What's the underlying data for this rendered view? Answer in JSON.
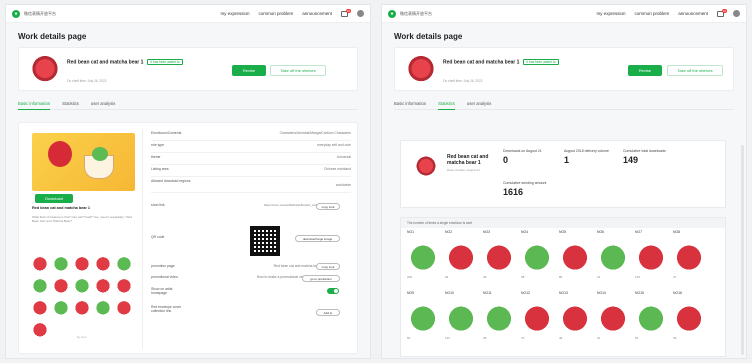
{
  "app": {
    "name": "微信表情开放平台"
  },
  "nav": {
    "my_expression": "my expression",
    "common_problem": "common problem",
    "announcement": "announcement",
    "badge": "10"
  },
  "page_title": "Work details page",
  "work": {
    "name": "Red bean cat and matcha bear 1",
    "tag": "It has been added to",
    "shelf_time": "On shelf time: July 26, 2022",
    "revise_label": "Revise",
    "take_off_label": "Take off the shelves"
  },
  "tabs": [
    "Basic information",
    "Statistics",
    "user analysis"
  ],
  "left": {
    "download_label": "Download",
    "side_name": "Red bean cat and matcha bear 1",
    "description": "What kind of creature is this? Can eat? Fluid? Yes, meet it separately: \"Red Bean Cat\" and \"Matcha Bear\"!",
    "footnote": "by luvc",
    "info": [
      {
        "k": "Emoticons/Contents",
        "v": "Characters/Animals/Manga/Cartoon Characters"
      },
      {
        "k": "role type",
        "v": "everyday self and cute"
      },
      {
        "k": "theme",
        "v": "Universal"
      },
      {
        "k": "Listing area",
        "v": "Chinese mainland"
      },
      {
        "k": "Allowed download regions",
        "v": "worldwide"
      },
      {
        "k": "short link",
        "v": "https://xxxx.xxxx/ezl6eh4/eHhcs/ac_cxdunvs"
      },
      {
        "k": "QR code",
        "v": ""
      },
      {
        "k": "promotion page",
        "v": "Red bean cat and matcha bear 1"
      },
      {
        "k": "promotional video",
        "v": "How to make a promotional video?"
      },
      {
        "k": "Show on artist homepage",
        "v": ""
      },
      {
        "k": "Red envelope cover collection link",
        "v": ""
      }
    ],
    "copy_link": "copy Link",
    "download_large": "download large image",
    "go_production": "go to production",
    "add_to": "Add to"
  },
  "stats": {
    "name": "Red bean cat and matcha bear 1",
    "date": "Data of today: August 21",
    "m1_label": "Downloads on August 21",
    "m1_value": "0",
    "m2_label": "August 2016 delivery volume",
    "m2_value": "1",
    "m3_label": "Cumulative total downloads",
    "m3_value": "149",
    "m4_label": "Cumulative sending amount",
    "m4_value": "1616",
    "grid_title": "The number of times a single emoticon is sent",
    "cells": [
      {
        "label": "NO1",
        "count": "200",
        "color": "g"
      },
      {
        "label": "NO2",
        "count": "94",
        "color": "r"
      },
      {
        "label": "NO3",
        "count": "46",
        "color": "r"
      },
      {
        "label": "NO4",
        "count": "58",
        "color": "g"
      },
      {
        "label": "NO5",
        "count": "86",
        "color": "r"
      },
      {
        "label": "NO6",
        "count": "41",
        "color": "g"
      },
      {
        "label": "NO7",
        "count": "125",
        "color": "r"
      },
      {
        "label": "NO8",
        "count": "37",
        "color": "r"
      },
      {
        "label": "NO9",
        "count": "50",
        "color": "g"
      },
      {
        "label": "NO10",
        "count": "113",
        "color": "g"
      },
      {
        "label": "NO11",
        "count": "35",
        "color": "g"
      },
      {
        "label": "NO12",
        "count": "70",
        "color": "r"
      },
      {
        "label": "NO13",
        "count": "48",
        "color": "r"
      },
      {
        "label": "NO14",
        "count": "61",
        "color": "r"
      },
      {
        "label": "NO15",
        "count": "52",
        "color": "g"
      },
      {
        "label": "NO16",
        "count": "39",
        "color": "r"
      }
    ]
  },
  "colors": {
    "accent": "#1aae4a",
    "brand_red": "#d62b37",
    "matcha": "#5cba52"
  }
}
